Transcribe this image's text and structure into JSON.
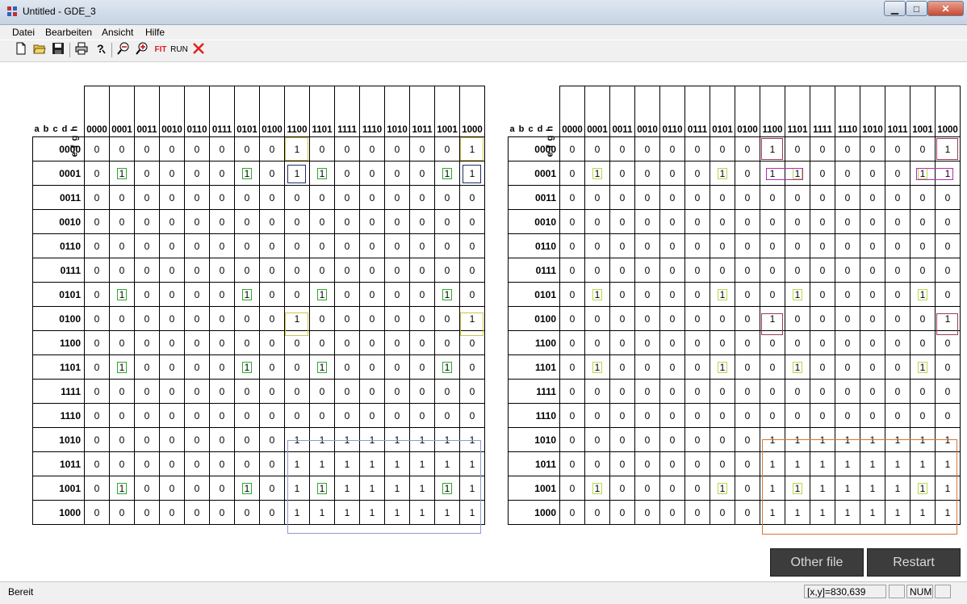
{
  "window": {
    "title": "Untitled - GDE_3",
    "min": "▁",
    "max": "□",
    "close": "✕"
  },
  "menu": [
    "Datei",
    "Bearbeiten",
    "Ansicht",
    "Hilfe"
  ],
  "toolbar": {
    "new_icon": "new-document-icon",
    "open_icon": "open-folder-icon",
    "save_icon": "save-disk-icon",
    "print_icon": "printer-icon",
    "help_icon": "help-question-icon",
    "zoom_out_icon": "zoom-out-icon",
    "zoom_in_icon": "zoom-in-icon",
    "fit_label": "FIT",
    "run_label": "RUN",
    "stop_icon": "red-x-icon"
  },
  "kmap": {
    "row_var_label": "a b c d",
    "col_var_label": "e f g h",
    "col_labels": [
      "0000",
      "0001",
      "0011",
      "0010",
      "0110",
      "0111",
      "0101",
      "0100",
      "1100",
      "1101",
      "1111",
      "1110",
      "1010",
      "1011",
      "1001",
      "1000"
    ],
    "row_labels": [
      "0000",
      "0001",
      "0011",
      "0010",
      "0110",
      "0111",
      "0101",
      "0100",
      "1100",
      "1101",
      "1111",
      "1110",
      "1010",
      "1011",
      "1001",
      "1000"
    ],
    "values": [
      "0000000010000001",
      "0100001011000011",
      "0000000000000000",
      "0000000000000000",
      "0000000000000000",
      "0000000000000000",
      "0100001001000010",
      "0000000010000001",
      "0000000000000000",
      "0100001001000010",
      "0000000000000000",
      "0000000000000000",
      "0000000011111111",
      "0000000011111111",
      "0100001011111111",
      "0000000011111111"
    ]
  },
  "colors": {
    "green": "#2ea82e",
    "lime": "#b6d94a",
    "navy": "#1f2d6b",
    "yellow": "#d2c24a",
    "blue": "#8d9bd2",
    "maroon": "#9a3b52",
    "magenta": "#b02ab8",
    "orange": "#d8742e"
  },
  "buttons": {
    "other_file": "Other file",
    "restart": "Restart"
  },
  "status": {
    "text": "Bereit",
    "coords": "[x,y]=830,639",
    "num": "NUM"
  }
}
